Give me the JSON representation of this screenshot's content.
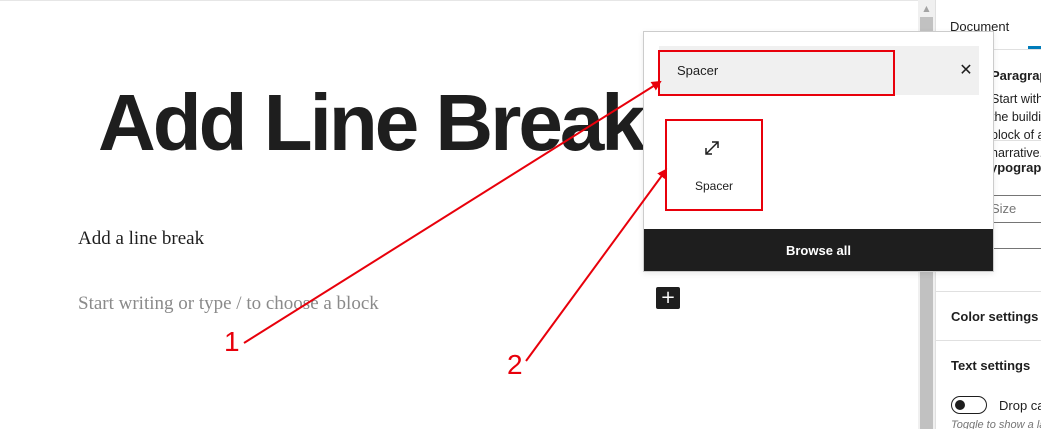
{
  "editor": {
    "title": "Add Line Break",
    "paragraph": "Add a line break",
    "placeholder": "Start writing or type / to choose a block",
    "add_block_icon": "plus-icon"
  },
  "inserter": {
    "search_value": "Spacer",
    "clear_icon": "close-icon",
    "result": {
      "label": "Spacer",
      "icon": "spacer-resize-icon"
    },
    "browse_all_label": "Browse all"
  },
  "sidebar": {
    "tab_document": "Document",
    "paragraph_title": "Paragraph",
    "paragraph_desc": "Start with the building block of all narrative.",
    "typography_title": "Typography",
    "size_placeholder": "Size",
    "color_settings": "Color settings",
    "text_settings": "Text settings",
    "drop_cap_label": "Drop cap",
    "drop_cap_help": "Toggle to show a large initial letter."
  },
  "annotations": {
    "label_1": "1",
    "label_2": "2",
    "color": "#e8000b"
  },
  "colors": {
    "accent": "#007cba",
    "dark": "#1e1e1e",
    "annotation": "#e8000b"
  }
}
